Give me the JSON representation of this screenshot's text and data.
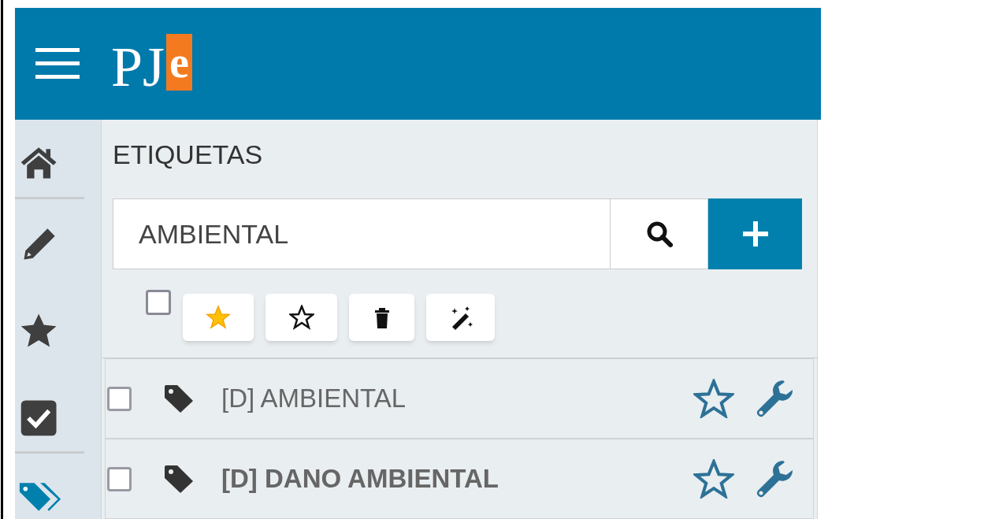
{
  "header": {
    "logo": "PJ",
    "logo_letter": "e"
  },
  "sidebar": {
    "items": [
      {
        "kind": "home",
        "selected": false
      },
      {
        "kind": "edit",
        "selected": false
      },
      {
        "kind": "star",
        "selected": false
      },
      {
        "kind": "check",
        "selected": false
      },
      {
        "kind": "tags",
        "selected": true
      }
    ]
  },
  "panel": {
    "title": "ETIQUETAS",
    "search": {
      "value": "AMBIENTAL"
    },
    "select_all": {
      "checked": false
    },
    "actions": [
      {
        "kind": "star-filled"
      },
      {
        "kind": "star-outline"
      },
      {
        "kind": "trash"
      },
      {
        "kind": "magic"
      }
    ]
  },
  "tags": [
    {
      "label": "[D] AMBIENTAL",
      "checked": false,
      "bold": false
    },
    {
      "label": "[D] DANO AMBIENTAL",
      "checked": false,
      "bold": true
    }
  ]
}
